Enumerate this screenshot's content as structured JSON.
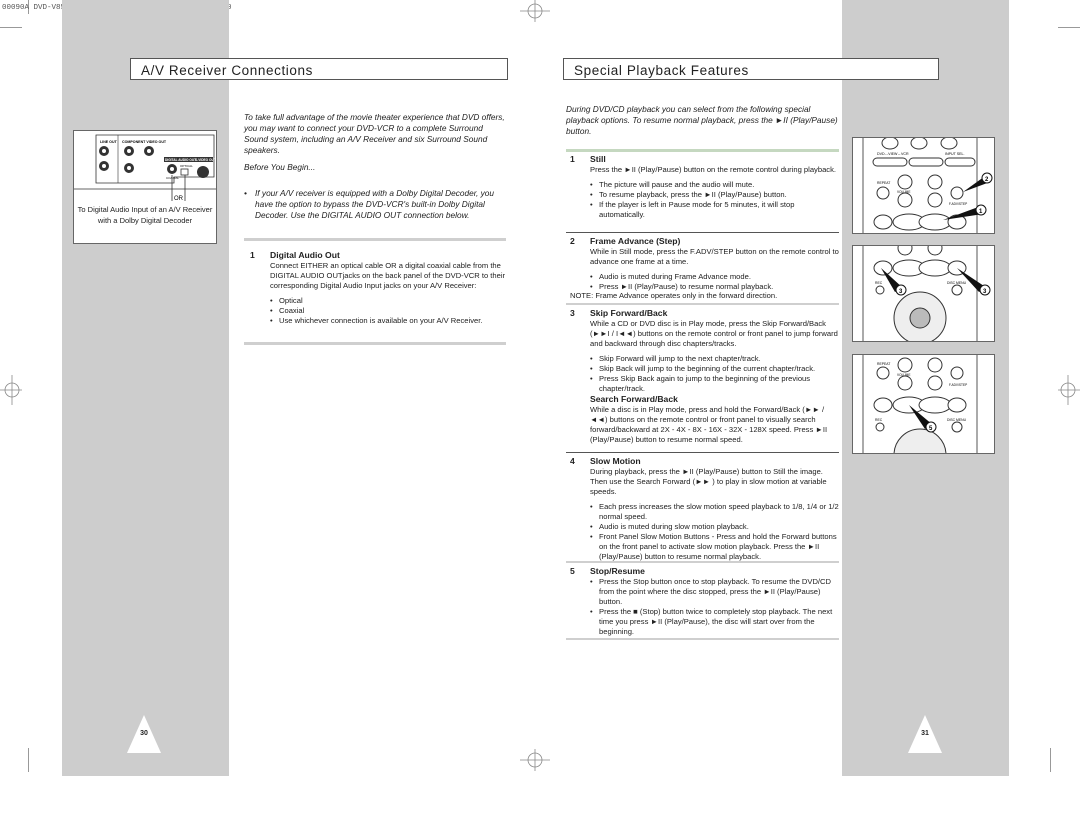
{
  "slug": "00090A DVD-V85K/XTC-Eng2  9/17/02 11:31 AM  Page 30",
  "left_page": {
    "title": "A/V Receiver Connections",
    "figure": {
      "labels": {
        "line_out": "LINE OUT",
        "component_video_out": "COMPONENT VIDEO OUT",
        "digital_audio_out": "DIGITAL AUDIO OUT",
        "s_video_out": "S-VIDEO OUT",
        "optical": "OPTICAL",
        "coaxial": "COAXIAL",
        "or": "OR"
      },
      "caption": "To Digital Audio Input of an A/V Receiver with a Dolby Digital Decoder"
    },
    "intro": "To take full advantage of the movie theater experience that DVD offers, you may want to connect your DVD-VCR to a complete Surround Sound system, including an A/V Receiver and six Surround Sound speakers.",
    "before_label": "Before You Begin...",
    "before_bullet": "If your A/V receiver is equipped with a Dolby Digital Decoder, you have the option to bypass the DVD-VCR's built-in Dolby Digital Decoder. Use the DIGITAL AUDIO OUT connection below.",
    "section": {
      "number": "1",
      "heading": "Digital Audio Out",
      "text": "Connect EITHER an optical cable OR a digital coaxial cable from the DIGITAL AUDIO OUTjacks on the back panel of the DVD-VCR to their corresponding Digital Audio Input jacks on your A/V Receiver:",
      "bullets": [
        "Optical",
        "Coaxial",
        "Use whichever connection is available on your A/V Receiver."
      ]
    },
    "page_number": "30"
  },
  "right_page": {
    "title": "Special Playback Features",
    "intro": "During DVD/CD playback you can select from the following special playback options. To resume normal playback, press the ►II (Play/Pause) button.",
    "sections": [
      {
        "number": "1",
        "heading": "Still",
        "text": "Press the ►II (Play/Pause) button on the remote control during playback.",
        "bullets": [
          "The picture will pause and the audio will mute.",
          "To resume playback, press the ►II (Play/Pause) button.",
          "If the player is left in Pause mode for 5 minutes, it will stop automatically."
        ]
      },
      {
        "number": "2",
        "heading": "Frame Advance (Step)",
        "text": "While in Still mode, press the F.ADV/STEP button on the remote control to advance one frame at a time.",
        "bullets": [
          "Audio is muted during Frame Advance mode.",
          "Press ►II (Play/Pause) to resume normal playback."
        ],
        "note": "NOTE: Frame Advance operates only in the forward direction."
      },
      {
        "number": "3",
        "heading": "Skip Forward/Back",
        "text": "While a CD or DVD disc is in Play mode, press the Skip Forward/Back (►►I / I◄◄) buttons on the remote control or front panel to jump forward and backward through disc chapters/tracks.",
        "bullets": [
          "Skip Forward will jump to the next chapter/track.",
          "Skip Back will jump to the beginning of the current chapter/track.",
          "Press Skip Back again to jump to the beginning of the previous chapter/track."
        ],
        "sub_heading": "Search Forward/Back",
        "sub_text": "While a disc is in Play mode, press and hold the Forward/Back (►► / ◄◄) buttons on the remote control or front panel to visually search forward/backward at 2X - 4X - 8X - 16X - 32X - 128X speed. Press ►II (Play/Pause) button to resume normal speed."
      },
      {
        "number": "4",
        "heading": "Slow Motion",
        "text": "During playback, press the ►II (Play/Pause) button to Still the image. Then use the Search Forward (►► ) to play in slow motion at variable speeds.",
        "bullets": [
          "Each press increases the slow motion speed playback to 1/8, 1/4 or 1/2 normal speed.",
          "Audio is muted during slow motion playback.",
          "Front Panel Slow Motion Buttons - Press and hold the Forward buttons on the front panel to activate slow motion playback. Press the ►II (Play/Pause) button to resume normal playback."
        ]
      },
      {
        "number": "5",
        "heading": "Stop/Resume",
        "bullets": [
          "Press the Stop button once to stop playback. To resume the DVD/CD from the point where the disc stopped, press the ►II (Play/Pause) button.",
          "Press the ■ (Stop) button twice to completely stop playback. The next time you press ►II (Play/Pause), the disc will start over from the beginning."
        ]
      }
    ],
    "remote_figures": [
      {
        "callouts": [
          "2",
          "1"
        ],
        "labels": [
          "DVD↔VIEW↔VCR",
          "INPUT SEL.",
          "REPEAT",
          "VOLUME",
          "CH",
          "F.ADV/STEP"
        ]
      },
      {
        "callouts": [
          "3",
          "3"
        ],
        "labels": [
          "REC",
          "DISC MENU"
        ]
      },
      {
        "callouts": [
          "5"
        ],
        "labels": [
          "REPEAT",
          "VOLUME",
          "F.ADV/STEP",
          "REC",
          "DISC MENU"
        ]
      }
    ],
    "page_number": "31"
  }
}
